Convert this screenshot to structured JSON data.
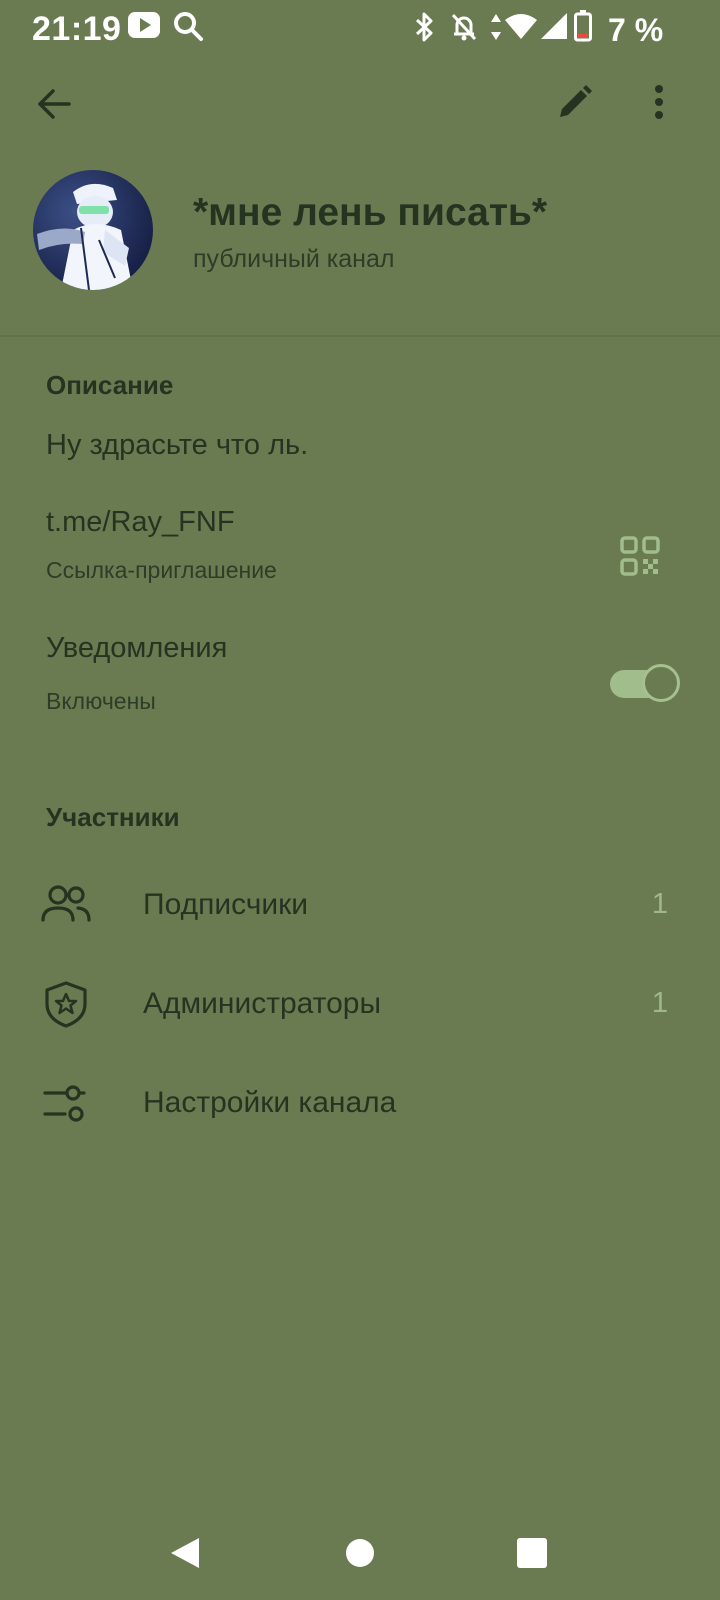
{
  "status_bar": {
    "time": "21:19",
    "battery_percent": "7 %",
    "icons": [
      "youtube-icon",
      "search-icon",
      "bluetooth-icon",
      "bell-off-icon",
      "data-arrows-icon",
      "wifi-icon",
      "signal-icon",
      "battery-icon"
    ]
  },
  "toolbar": {
    "back_icon": "arrow-left-icon",
    "edit_icon": "pencil-icon",
    "more_icon": "more-vertical-icon"
  },
  "channel": {
    "title": "*мне лень писать*",
    "subtitle": "публичный канал"
  },
  "description": {
    "section_title": "Описание",
    "text": "Ну здрасьте что ль."
  },
  "invite_link": {
    "link": "t.me/Ray_FNF",
    "caption": "Ссылка-приглашение",
    "qr_icon": "qr-code-icon"
  },
  "notifications": {
    "label": "Уведомления",
    "status": "Включены",
    "enabled": true
  },
  "participants": {
    "section_title": "Участники",
    "items": [
      {
        "label": "Подписчики",
        "count": "1",
        "icon": "users-icon"
      },
      {
        "label": "Администраторы",
        "count": "1",
        "icon": "shield-star-icon"
      },
      {
        "label": "Настройки канала",
        "count": "",
        "icon": "sliders-icon"
      }
    ]
  },
  "colors": {
    "background": "#6b7b51",
    "text_primary": "#243420",
    "accent": "#a2bd8c",
    "status_bar_text": "#ffffff"
  },
  "nav_bar": {
    "back": "nav-back-icon",
    "home": "nav-home-icon",
    "recents": "nav-recents-icon"
  }
}
